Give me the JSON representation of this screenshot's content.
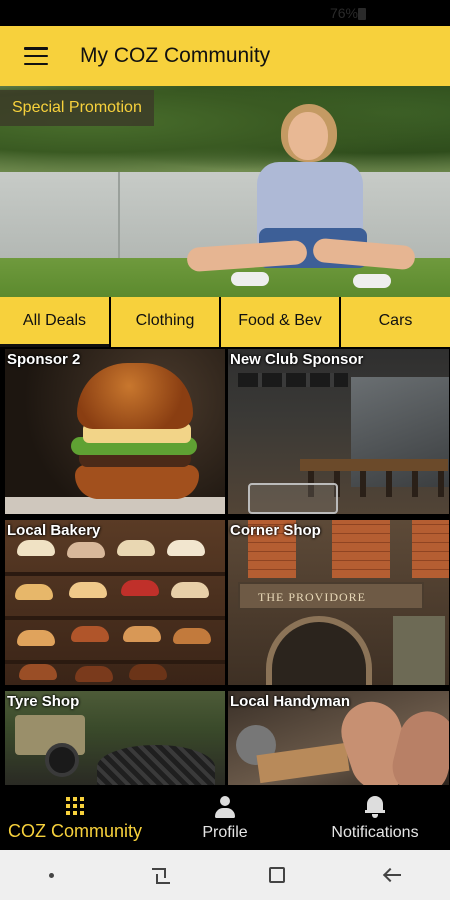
{
  "status_bar": {
    "battery_text": "76%"
  },
  "app_bar": {
    "title": "My COZ Community",
    "menu_icon": "hamburger-menu-icon"
  },
  "hero": {
    "badge": "Special Promotion"
  },
  "tabs": [
    {
      "label": "All Deals",
      "active": true
    },
    {
      "label": "Clothing",
      "active": false
    },
    {
      "label": "Food & Bev",
      "active": false
    },
    {
      "label": "Cars",
      "active": false
    }
  ],
  "deals": [
    {
      "title": "Sponsor 2"
    },
    {
      "title": "New Club Sponsor"
    },
    {
      "title": "Local Bakery"
    },
    {
      "title": "Corner Shop"
    },
    {
      "title": "Tyre Shop"
    },
    {
      "title": "Local Handyman"
    }
  ],
  "shop_sign": "THE PROVIDORE",
  "bottom_nav": [
    {
      "label": "COZ Community",
      "icon": "grid-icon",
      "active": true
    },
    {
      "label": "Profile",
      "icon": "person-icon",
      "active": false
    },
    {
      "label": "Notifications",
      "icon": "bell-icon",
      "active": false
    }
  ],
  "colors": {
    "accent": "#f7d13c",
    "background": "#000000",
    "text_dark": "#111111"
  }
}
